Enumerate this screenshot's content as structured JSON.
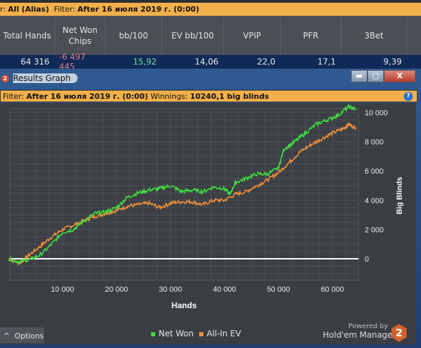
{
  "filter_bar": {
    "label1": "r: ",
    "value1": "All (Alias)",
    "label2": "Filter: ",
    "value2": "After 16 июля 2019 г. (0:00)"
  },
  "stats": {
    "headers": [
      "Total Hands",
      "Net Won Chips",
      "bb/100",
      "EV bb/100",
      "VPIP",
      "PFR",
      "3Bet"
    ],
    "values": [
      "64 316",
      "-6 497 445",
      "15,92",
      "14,06",
      "22,0",
      "17,1",
      "9,39"
    ]
  },
  "window": {
    "title": "Results Graph",
    "icon": "2",
    "minimize": "▬",
    "maximize": "▢",
    "close": "X"
  },
  "graph_filter": {
    "label": "Filter: ",
    "value": "After 16 июля 2019 г. (0:00)",
    "winnings_label": " Winnings: ",
    "winnings_value": "10240,1 big blinds",
    "help": "?"
  },
  "options_label": "Options",
  "options_caret": "^",
  "powered_by": "Powered by",
  "brand": "Hold'em Manager",
  "brand_badge": "2",
  "colors": {
    "net_won": "#3fe040",
    "all_in_ev": "#f0903a",
    "zero_line": "#ffffff"
  },
  "chart_data": {
    "type": "line",
    "xlabel": "Hands",
    "ylabel": "Big Blinds",
    "xlim": [
      0,
      65000
    ],
    "ylim": [
      -1500,
      11200
    ],
    "xticks": [
      10000,
      20000,
      30000,
      40000,
      50000,
      60000
    ],
    "xtick_labels": [
      "10 000",
      "20 000",
      "30 000",
      "40 000",
      "50 000",
      "60 000"
    ],
    "yticks": [
      0,
      2000,
      4000,
      6000,
      8000,
      10000
    ],
    "ytick_labels": [
      "0",
      "2 000",
      "4 000",
      "6 000",
      "8 000",
      "10 000"
    ],
    "grid": true,
    "legend": "bottom-center",
    "series": [
      {
        "name": "Net Won",
        "x": [
          0,
          2000,
          4000,
          6000,
          8000,
          10000,
          12000,
          14000,
          16000,
          18000,
          20000,
          22000,
          24000,
          26000,
          28000,
          30000,
          32000,
          34000,
          36000,
          38000,
          40000,
          41000,
          42000,
          44000,
          46000,
          48000,
          50000,
          51000,
          53000,
          55000,
          57000,
          59000,
          61000,
          63000,
          64316
        ],
        "y": [
          0,
          -200,
          -50,
          300,
          1000,
          1800,
          2000,
          2600,
          3100,
          3200,
          3500,
          4200,
          4500,
          4700,
          4800,
          5000,
          4600,
          4700,
          4600,
          4900,
          4800,
          4400,
          5200,
          5500,
          5800,
          5800,
          6200,
          7500,
          8000,
          8600,
          9200,
          9500,
          9800,
          10400,
          10240
        ]
      },
      {
        "name": "All-In EV",
        "x": [
          0,
          2000,
          4000,
          6000,
          8000,
          10000,
          12000,
          14000,
          16000,
          18000,
          20000,
          22000,
          24000,
          26000,
          28000,
          30000,
          32000,
          34000,
          36000,
          38000,
          40000,
          42000,
          44000,
          46000,
          48000,
          50000,
          52000,
          54000,
          56000,
          58000,
          60000,
          62000,
          63000,
          64316
        ],
        "y": [
          0,
          -300,
          300,
          900,
          1500,
          2000,
          2300,
          2600,
          2900,
          3100,
          3300,
          3600,
          3700,
          3800,
          3500,
          3800,
          3900,
          3900,
          3700,
          4000,
          4000,
          4400,
          4600,
          5000,
          5400,
          5900,
          6600,
          7300,
          7800,
          8200,
          8600,
          8900,
          9200,
          8950
        ]
      }
    ]
  }
}
